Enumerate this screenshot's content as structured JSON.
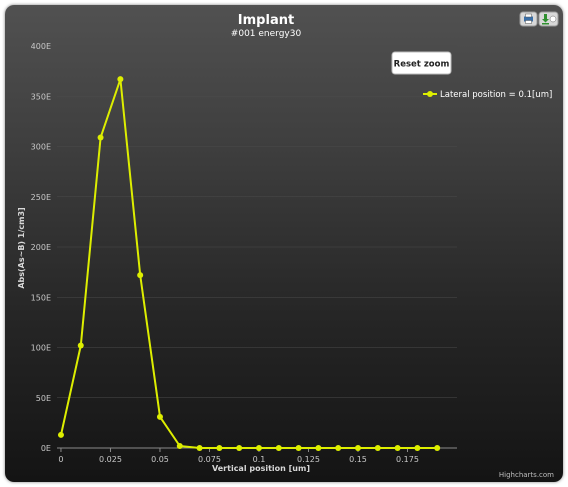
{
  "chart_data": {
    "type": "line",
    "title": "Implant",
    "subtitle": "#001 energy30",
    "xlabel": "Vertical position [um]",
    "ylabel": "Abs(As~B) 1/cm3]",
    "xlim": [
      -0.002,
      0.2
    ],
    "ylim": [
      0,
      400
    ],
    "xticks": [
      0,
      0.025,
      0.05,
      0.075,
      0.1,
      0.125,
      0.15,
      0.175
    ],
    "xtick_labels": [
      "0",
      "0.025",
      "0.05",
      "0.075",
      "0.1",
      "0.125",
      "0.15",
      "0.175"
    ],
    "yticks": [
      0,
      50,
      100,
      150,
      200,
      250,
      300,
      350,
      400
    ],
    "ytick_labels": [
      "0E",
      "50E",
      "100E",
      "150E",
      "200E",
      "250E",
      "300E",
      "350E",
      "400E"
    ],
    "grid": true,
    "legend_position": "top-right",
    "series": [
      {
        "name": "Lateral position = 0.1[um]",
        "color": "#ddee00",
        "x": [
          0,
          0.01,
          0.02,
          0.03,
          0.04,
          0.05,
          0.06,
          0.07,
          0.08,
          0.09,
          0.1,
          0.11,
          0.12,
          0.13,
          0.14,
          0.15,
          0.16,
          0.17,
          0.18,
          0.19
        ],
        "y": [
          13,
          102,
          309,
          367,
          172,
          31,
          2,
          0,
          0,
          0,
          0,
          0,
          0,
          0,
          0,
          0,
          0,
          0,
          0,
          0
        ]
      }
    ]
  },
  "controls": {
    "reset_zoom_label": "Reset zoom",
    "print_icon": "print-icon",
    "export_icon": "export-download-icon"
  },
  "credits": "Highcharts.com",
  "colors": {
    "grid": "#4a4a4a",
    "axis": "#8a8a8a",
    "series": "#ddee00"
  }
}
